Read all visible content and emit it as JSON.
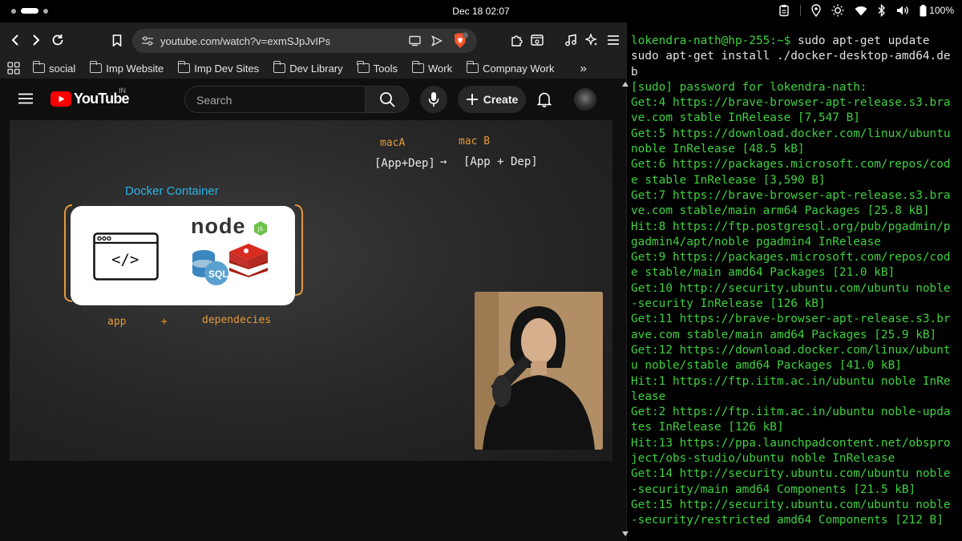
{
  "system_bar": {
    "datetime": "Dec 18  02:07",
    "battery": "100%"
  },
  "browser": {
    "url": "youtube.com/watch?v=exmSJpJvIPs",
    "bookmarks": [
      "social",
      "Imp Website",
      "Imp Dev Sites",
      "Dev Library",
      "Tools",
      "Work",
      "Compnay Work"
    ],
    "overflow": "»"
  },
  "youtube": {
    "logo_text": "YouTube",
    "region": "IN",
    "search_placeholder": "Search",
    "create_label": "Create"
  },
  "video": {
    "card_title": "Docker Container",
    "code_symbol": "</>",
    "node_label": "node",
    "sql_label": "SQL",
    "mac_a": "macA",
    "mac_b": "mac B",
    "left_box": "[App+Dep]",
    "arrow": "→",
    "right_box": "[App + Dep]",
    "app": "app",
    "plus": "+",
    "dependencies": "dependecies"
  },
  "terminal": {
    "prompt": "lokendra-nath@hp-255:~$",
    "command": " sudo apt-get update\nsudo apt-get install ./docker-desktop-amd64.deb",
    "output": "[sudo] password for lokendra-nath:\nGet:4 https://brave-browser-apt-release.s3.brave.com stable InRelease [7,547 B]\nGet:5 https://download.docker.com/linux/ubuntu noble InRelease [48.5 kB]\nGet:6 https://packages.microsoft.com/repos/code stable InRelease [3,590 B]\nGet:7 https://brave-browser-apt-release.s3.brave.com stable/main arm64 Packages [25.8 kB]\nHit:8 https://ftp.postgresql.org/pub/pgadmin/pgadmin4/apt/noble pgadmin4 InRelease\nGet:9 https://packages.microsoft.com/repos/code stable/main amd64 Packages [21.0 kB]\nGet:10 http://security.ubuntu.com/ubuntu noble-security InRelease [126 kB]\nGet:11 https://brave-browser-apt-release.s3.brave.com stable/main amd64 Packages [25.9 kB]\nGet:12 https://download.docker.com/linux/ubuntu noble/stable amd64 Packages [41.0 kB]\nHit:1 https://ftp.iitm.ac.in/ubuntu noble InRelease\nGet:2 https://ftp.iitm.ac.in/ubuntu noble-updates InRelease [126 kB]\nHit:13 https://ppa.launchpadcontent.net/obsproject/obs-studio/ubuntu noble InRelease\nGet:14 http://security.ubuntu.com/ubuntu noble-security/main amd64 Components [21.5 kB]\nGet:15 http://security.ubuntu.com/ubuntu noble-security/restricted amd64 Components [212 B]"
  }
}
